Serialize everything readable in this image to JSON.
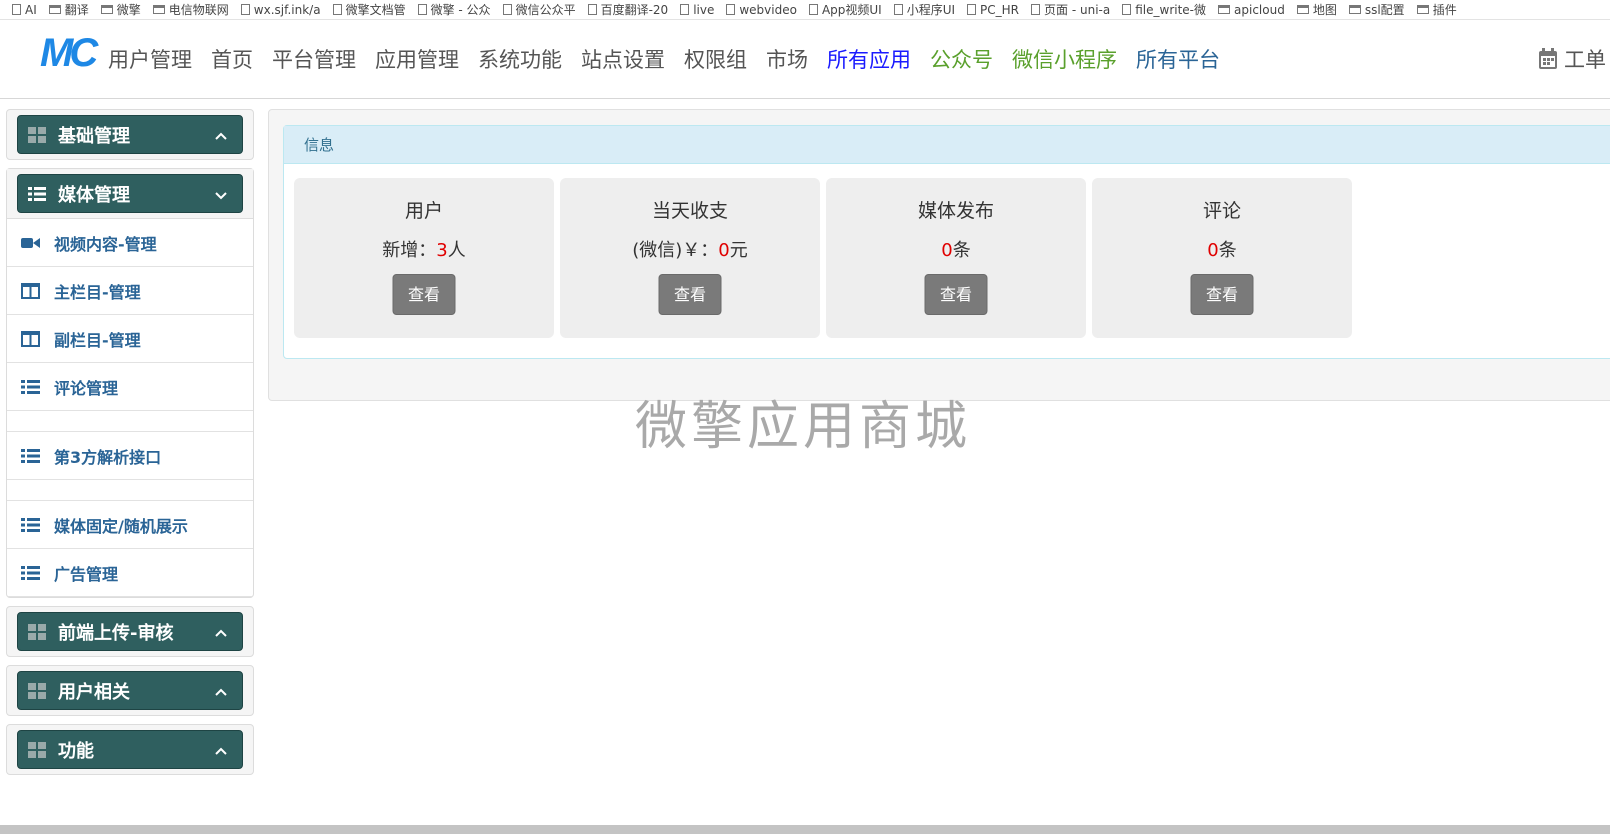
{
  "bookmarks": [
    {
      "label": "AI",
      "type": "page"
    },
    {
      "label": "翻译",
      "type": "folder"
    },
    {
      "label": "微擎",
      "type": "folder"
    },
    {
      "label": "电信物联网",
      "type": "folder"
    },
    {
      "label": "wx.sjf.ink/a",
      "type": "page"
    },
    {
      "label": "微擎文档管",
      "type": "page"
    },
    {
      "label": "微擎 - 公众",
      "type": "page"
    },
    {
      "label": "微信公众平",
      "type": "page"
    },
    {
      "label": "百度翻译-20",
      "type": "page"
    },
    {
      "label": "live",
      "type": "page"
    },
    {
      "label": "webvideo",
      "type": "page"
    },
    {
      "label": "App视频UI",
      "type": "page"
    },
    {
      "label": "小程序UI",
      "type": "page"
    },
    {
      "label": "PC_HR",
      "type": "page"
    },
    {
      "label": "页面 - uni-a",
      "type": "page"
    },
    {
      "label": "file_write-微",
      "type": "page"
    },
    {
      "label": "apicloud",
      "type": "folder"
    },
    {
      "label": "地图",
      "type": "folder"
    },
    {
      "label": "ssl配置",
      "type": "folder"
    },
    {
      "label": "插件",
      "type": "folder"
    }
  ],
  "navbar": {
    "logo_text": "MC",
    "items": [
      {
        "label": "用户管理",
        "color": "#555555"
      },
      {
        "label": "首页",
        "color": "#555555"
      },
      {
        "label": "平台管理",
        "color": "#555555"
      },
      {
        "label": "应用管理",
        "color": "#555555"
      },
      {
        "label": "系统功能",
        "color": "#555555"
      },
      {
        "label": "站点设置",
        "color": "#555555"
      },
      {
        "label": "权限组",
        "color": "#555555"
      },
      {
        "label": "市场",
        "color": "#555555"
      },
      {
        "label": "所有应用",
        "color": "#1a1aff"
      },
      {
        "label": "公众号",
        "color": "#5aa02c"
      },
      {
        "label": "微信小程序",
        "color": "#5aa02c"
      },
      {
        "label": "所有平台",
        "color": "#2a6496"
      }
    ],
    "right_label": "工单"
  },
  "sidebar": {
    "panels": [
      {
        "title": "基础管理",
        "icon": "grid-icon",
        "chevron": "up",
        "open": false,
        "items": []
      },
      {
        "title": "媒体管理",
        "icon": "list-icon",
        "chevron": "down",
        "open": true,
        "items": [
          {
            "label": "视频内容-管理",
            "icon": "video-icon"
          },
          {
            "label": "主栏目-管理",
            "icon": "columns-icon"
          },
          {
            "label": "副栏目-管理",
            "icon": "columns-icon"
          },
          {
            "label": "评论管理",
            "icon": "list-icon"
          },
          {
            "label": "",
            "icon": "",
            "gap": true
          },
          {
            "label": "第3方解析接口",
            "icon": "list-icon"
          },
          {
            "label": "",
            "icon": "",
            "gap": true
          },
          {
            "label": "媒体固定/随机展示",
            "icon": "list-icon"
          },
          {
            "label": "广告管理",
            "icon": "list-icon"
          }
        ]
      },
      {
        "title": "前端上传-审核",
        "icon": "grid-icon",
        "chevron": "up",
        "open": false,
        "items": []
      },
      {
        "title": "用户相关",
        "icon": "grid-icon",
        "chevron": "up",
        "open": false,
        "items": []
      },
      {
        "title": "功能",
        "icon": "grid-icon",
        "chevron": "up",
        "open": false,
        "items": []
      }
    ]
  },
  "info": {
    "header": "信息",
    "cards": [
      {
        "title": "用户",
        "prefix": "新增：",
        "value": "3",
        "suffix": "人",
        "button": "查看"
      },
      {
        "title": "当天收支",
        "prefix": "(微信)￥：",
        "value": "0",
        "suffix": "元",
        "button": "查看"
      },
      {
        "title": "媒体发布",
        "prefix": "",
        "value": "0",
        "suffix": "条",
        "button": "查看"
      },
      {
        "title": "评论",
        "prefix": "",
        "value": "0",
        "suffix": "条",
        "button": "查看"
      }
    ]
  },
  "watermark": "微擎应用商城"
}
